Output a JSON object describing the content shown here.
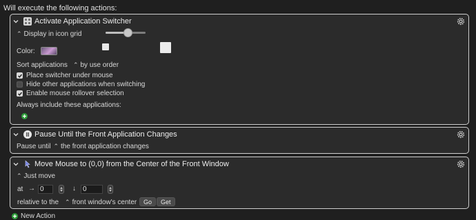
{
  "header_text": "Will execute the following actions:",
  "actions": [
    {
      "title": "Activate Application Switcher",
      "display_popup": "Display in icon grid",
      "icon_size_level": 0.55,
      "color_label": "Color:",
      "swatch_color": "#b07ab8",
      "sort_label": "Sort applications",
      "sort_value": "by use order",
      "checkboxes": [
        {
          "label": "Place switcher under mouse",
          "checked": true
        },
        {
          "label": "Hide other applications when switching",
          "checked": false
        },
        {
          "label": "Enable mouse rollover selection",
          "checked": true
        }
      ],
      "always_include_label": "Always include these applications:"
    },
    {
      "title": "Pause Until the Front Application Changes",
      "pause_label": "Pause until",
      "pause_value": "the front application changes"
    },
    {
      "title": "Move Mouse to (0,0) from the Center of the Front Window",
      "mode_value": "Just move",
      "at_label": "at",
      "x_value": "0",
      "y_value": "0",
      "relative_label": "relative to the",
      "relative_value": "front window's center",
      "go_label": "Go",
      "get_label": "Get"
    }
  ],
  "new_action_label": "New Action",
  "colors": {
    "background": "#1f1f1f",
    "block_background": "#2b2b2b",
    "block_border": "#cfcfcf",
    "add_green": "#2f9e3b"
  }
}
